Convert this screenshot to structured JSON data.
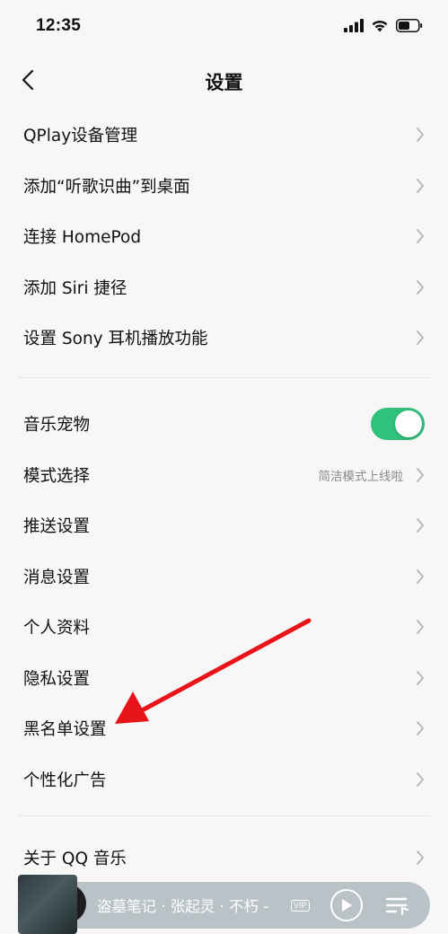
{
  "status_bar": {
    "time": "12:35",
    "icons": [
      "signal-icon",
      "wifi-icon",
      "battery-icon"
    ]
  },
  "nav": {
    "back_icon": "chevron-left-icon",
    "title": "设置"
  },
  "group1": [
    {
      "label": "QPlay设备管理"
    },
    {
      "label": "添加“听歌识曲”到桌面"
    },
    {
      "label": "连接 HomePod"
    },
    {
      "label": "添加 Siri 捷径"
    },
    {
      "label": "设置 Sony 耳机播放功能"
    }
  ],
  "group2": {
    "music_pet": {
      "label": "音乐宠物",
      "toggle_on": true
    },
    "mode": {
      "label": "模式选择",
      "value": "简洁模式上线啦"
    },
    "push": {
      "label": "推送设置"
    },
    "message": {
      "label": "消息设置"
    },
    "profile": {
      "label": "个人资料"
    },
    "privacy": {
      "label": "隐私设置"
    },
    "blacklist": {
      "label": "黑名单设置"
    },
    "ads": {
      "label": "个性化广告"
    }
  },
  "group3": {
    "about": {
      "label": "关于 QQ 音乐"
    }
  },
  "mini_player": {
    "song": "盗墓笔记 · 张起灵 · 不朽 -",
    "badge": "VIP"
  },
  "colors": {
    "accent_green": "#31c27c",
    "annotation_red": "#e8141a",
    "background": "#f7f7f7"
  }
}
